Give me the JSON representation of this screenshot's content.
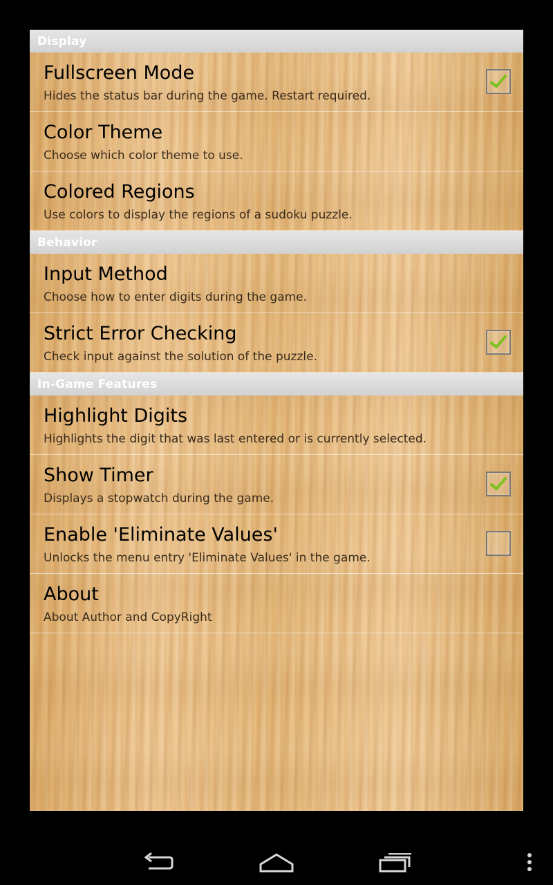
{
  "sections": [
    {
      "header": "Display",
      "items": [
        {
          "title": "Fullscreen Mode",
          "summary": "Hides the status bar during the game. Restart required.",
          "checkbox": "checked"
        },
        {
          "title": "Color Theme",
          "summary": "Choose which color theme to use.",
          "checkbox": "none"
        },
        {
          "title": "Colored Regions",
          "summary": "Use colors to display the regions of a sudoku puzzle.",
          "checkbox": "none"
        }
      ]
    },
    {
      "header": "Behavior",
      "items": [
        {
          "title": "Input Method",
          "summary": "Choose how to enter digits during the game.",
          "checkbox": "none"
        },
        {
          "title": "Strict Error Checking",
          "summary": "Check input against the solution of the puzzle.",
          "checkbox": "checked"
        }
      ]
    },
    {
      "header": "In-Game Features",
      "items": [
        {
          "title": "Highlight Digits",
          "summary": "Highlights the digit that was last entered or is currently selected.",
          "checkbox": "none"
        },
        {
          "title": "Show Timer",
          "summary": "Displays a stopwatch during the game.",
          "checkbox": "checked"
        },
        {
          "title": "Enable 'Eliminate Values'",
          "summary": "Unlocks the menu entry 'Eliminate Values' in the game.",
          "checkbox": "unchecked"
        },
        {
          "title": "About",
          "summary": "About Author and CopyRight",
          "checkbox": "none"
        }
      ]
    }
  ],
  "navbar": {
    "buttons": [
      "back-icon",
      "home-icon",
      "recent-apps-icon",
      "menu-overflow-icon"
    ]
  },
  "colors": {
    "check_mark": "#7cc21e",
    "header_bg": "#d8d8d8",
    "wood": "#e2b574"
  }
}
